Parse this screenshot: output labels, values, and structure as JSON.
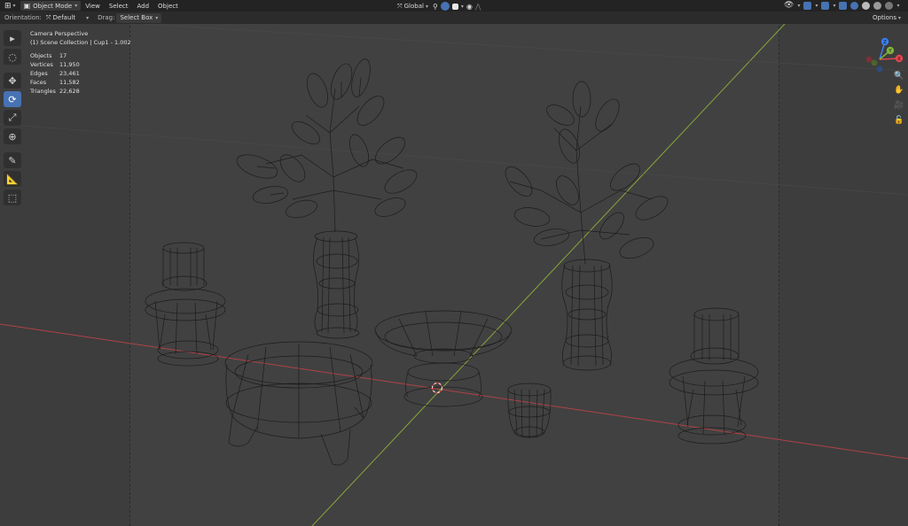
{
  "header": {
    "mode": "Object Mode",
    "menu": [
      "View",
      "Select",
      "Add",
      "Object"
    ],
    "transform_orientation": "Global"
  },
  "toolbar": {
    "orientation_label": "Orientation:",
    "orientation_value": "Default",
    "drag_label": "Drag:",
    "drag_value": "Select Box",
    "options_label": "Options"
  },
  "overlay": {
    "view_name": "Camera Perspective",
    "collection": "(1) Scene Collection | Cup1 - 1.002",
    "stats": [
      {
        "label": "Objects",
        "value": "17"
      },
      {
        "label": "Vertices",
        "value": "11,950"
      },
      {
        "label": "Edges",
        "value": "23,461"
      },
      {
        "label": "Faces",
        "value": "11,582"
      },
      {
        "label": "Triangles",
        "value": "22,628"
      }
    ]
  },
  "gizmo": {
    "axes": [
      {
        "label": "X",
        "color": "#e0464d"
      },
      {
        "label": "Y",
        "color": "#7fb33a"
      },
      {
        "label": "Z",
        "color": "#3b7ef0"
      }
    ]
  },
  "colors": {
    "accent": "#4772b3",
    "x_axis": "#c8484d",
    "y_axis": "#8fb03a"
  }
}
